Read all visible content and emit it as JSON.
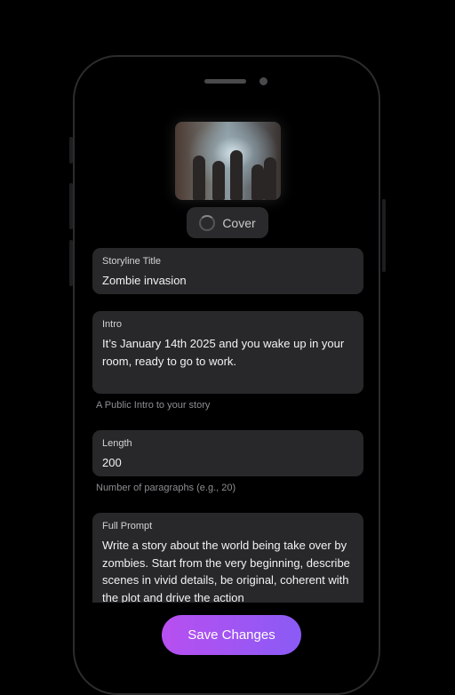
{
  "cover": {
    "button_label": "Cover",
    "image_icon": "zombie-cover-image"
  },
  "fields": {
    "title": {
      "label": "Storyline Title",
      "value": "Zombie invasion"
    },
    "intro": {
      "label": "Intro",
      "value": "It’s January 14th 2025 and you wake up in your room, ready to go to work.",
      "helper": "A Public Intro to your story"
    },
    "length": {
      "label": "Length",
      "value": "200",
      "helper": "Number of paragraphs (e.g., 20)"
    },
    "prompt": {
      "label": "Full Prompt",
      "value": "Write a story about the world being take over by zombies. Start from the very beginning, describe scenes in vivid details, be original, coherent with the plot and drive the action"
    }
  },
  "actions": {
    "save_label": "Save Changes"
  },
  "colors": {
    "accent_start": "#b84ff0",
    "accent_end": "#8a5bf5",
    "field_bg": "#28282b"
  }
}
